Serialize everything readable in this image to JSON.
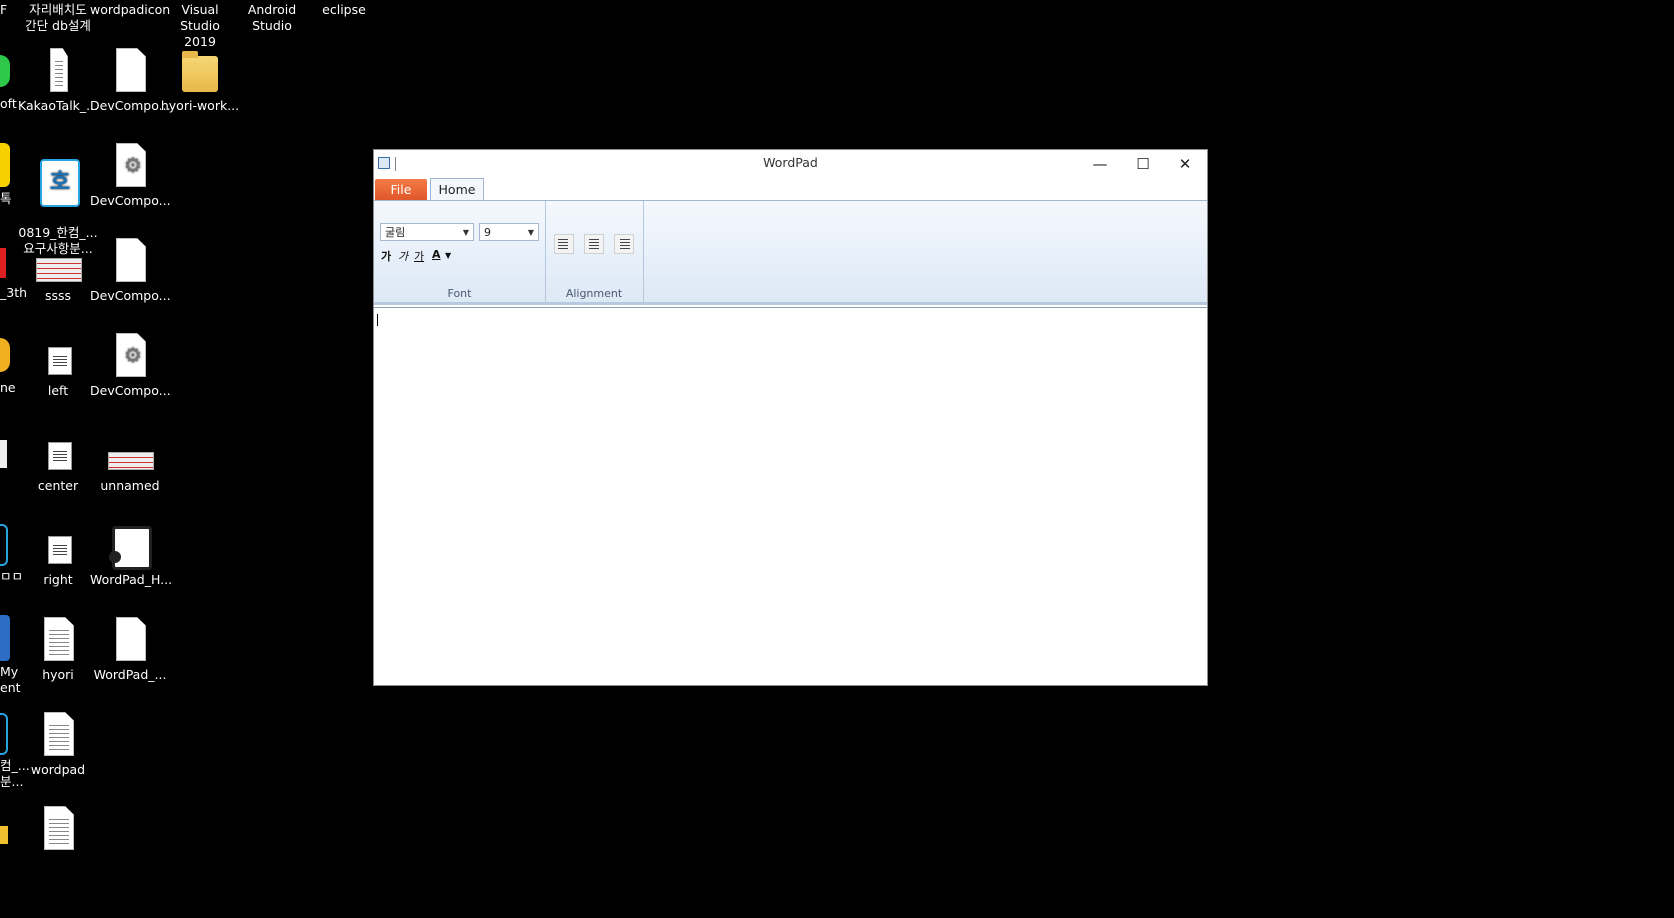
{
  "desktop": {
    "top_row": [
      "자리배치도\n간단 db설계",
      "wordpadicon",
      "Visual Studio\n2019",
      "Android\nStudio",
      "eclipse"
    ],
    "icons": [
      {
        "label": "KakaoTalk_...",
        "icon": "long-document-icon"
      },
      {
        "label": "DevCompo...",
        "icon": "document-icon"
      },
      {
        "label": "hyori-work...",
        "icon": "folder-icon"
      },
      {
        "label": "0819_한컴_...\n요구사항분...",
        "icon": "hancom-document-icon"
      },
      {
        "label": "DevCompo...",
        "icon": "gear-document-icon"
      },
      {
        "label": "ssss",
        "icon": "image-thumbnail-icon"
      },
      {
        "label": "DevCompo...",
        "icon": "document-icon"
      },
      {
        "label": "left",
        "icon": "align-left-document-icon"
      },
      {
        "label": "DevCompo...",
        "icon": "gear-document-icon"
      },
      {
        "label": "center",
        "icon": "align-center-document-icon"
      },
      {
        "label": "unnamed",
        "icon": "image-thumbnail-icon"
      },
      {
        "label": "right",
        "icon": "align-right-document-icon"
      },
      {
        "label": "WordPad_H...",
        "icon": "plugin-document-icon"
      },
      {
        "label": "hyori",
        "icon": "text-document-icon"
      },
      {
        "label": "WordPad_...",
        "icon": "document-icon"
      },
      {
        "label": "wordpad",
        "icon": "text-document-icon"
      }
    ],
    "partial_left": [
      "F",
      "oft",
      "톡",
      "_3th",
      "ne",
      "ㅁㅁ",
      "My\nent",
      "컴_...\n분..."
    ]
  },
  "window": {
    "title": "WordPad",
    "controls": {
      "minimize": "—",
      "maximize": "☐",
      "close": "✕"
    },
    "tabs": {
      "file": "File",
      "home": "Home"
    },
    "font_group": {
      "label": "Font",
      "font_name": "굴림",
      "font_size": "9",
      "bold": "가",
      "italic": "가",
      "underline": "가",
      "color": "A"
    },
    "alignment_group": {
      "label": "Alignment"
    }
  },
  "colors": {
    "file_tab": "#e0572a",
    "ribbon": "#dde9f6",
    "desktop": "#000000"
  }
}
